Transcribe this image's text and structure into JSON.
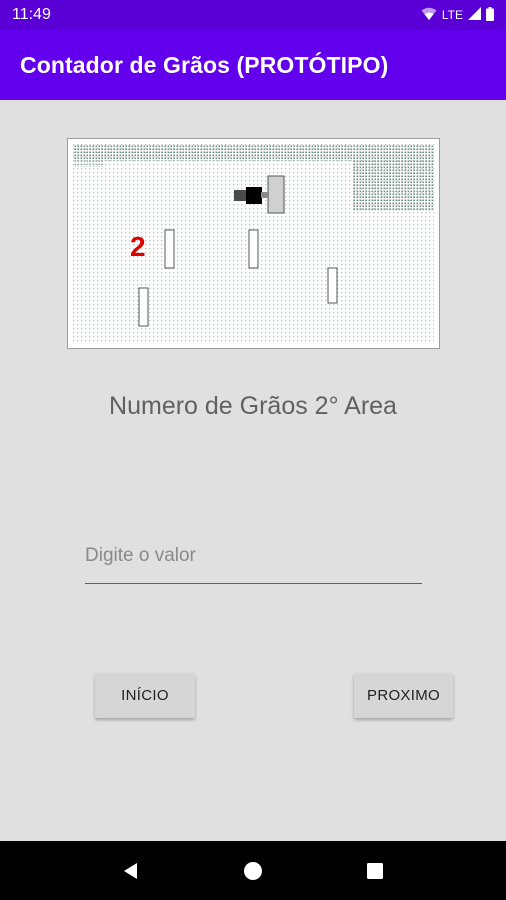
{
  "status_bar": {
    "time": "11:49",
    "network_label": "LTE",
    "icons": [
      "wifi-icon",
      "signal-icon",
      "battery-icon"
    ]
  },
  "app_bar": {
    "title": "Contador de Grãos (PROTÓTIPO)",
    "color": "#6200ee",
    "status_color": "#5a00d6"
  },
  "grain_image": {
    "area_number": "2",
    "marker_color": "#e00000"
  },
  "main": {
    "heading": "Numero de Grãos 2° Area",
    "input": {
      "placeholder": "Digite o valor",
      "value": ""
    },
    "buttons": {
      "start_label": "INÍCIO",
      "next_label": "PROXIMO"
    }
  },
  "nav_bar": {
    "icons": [
      "back-icon",
      "home-icon",
      "recents-icon"
    ]
  }
}
